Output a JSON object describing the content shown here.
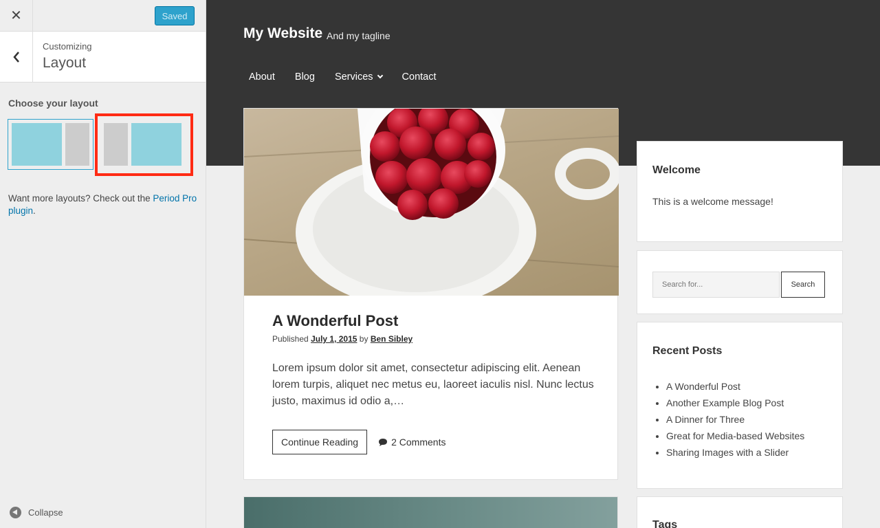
{
  "customizer": {
    "close_icon": "close-icon",
    "saved_label": "Saved",
    "accent": "#2ea2cc",
    "breadcrumb": "Customizing",
    "section_title": "Layout",
    "choose_label": "Choose your layout",
    "layout_options": [
      "content-left-sidebar-right",
      "sidebar-left-content-right"
    ],
    "more_text_prefix": "Want more layouts? Check out the ",
    "more_link": "Period Pro plugin",
    "more_text_suffix": ".",
    "collapse_label": "Collapse"
  },
  "site": {
    "title": "My Website",
    "tagline": "And my tagline",
    "nav": [
      "About",
      "Blog",
      "Services",
      "Contact"
    ]
  },
  "post": {
    "title": "A Wonderful Post",
    "published_prefix": "Published",
    "date": "July 1, 2015",
    "by": "by",
    "author": "Ben Sibley",
    "excerpt": "Lorem ipsum dolor sit amet, consectetur adipiscing elit. Aenean lorem turpis, aliquet nec metus eu, laoreet iaculis nisl. Nunc lectus justo, maximus id odio a,…",
    "continue_label": "Continue Reading",
    "comments": "2 Comments"
  },
  "widgets": {
    "welcome_title": "Welcome",
    "welcome_text": "This is a welcome message!",
    "search_placeholder": "Search for...",
    "search_button": "Search",
    "recent_title": "Recent Posts",
    "recent_posts": [
      "A Wonderful Post",
      "Another Example Blog Post",
      "A Dinner for Three",
      "Great for Media-based Websites",
      "Sharing Images with a Slider"
    ],
    "tags_title": "Tags"
  }
}
